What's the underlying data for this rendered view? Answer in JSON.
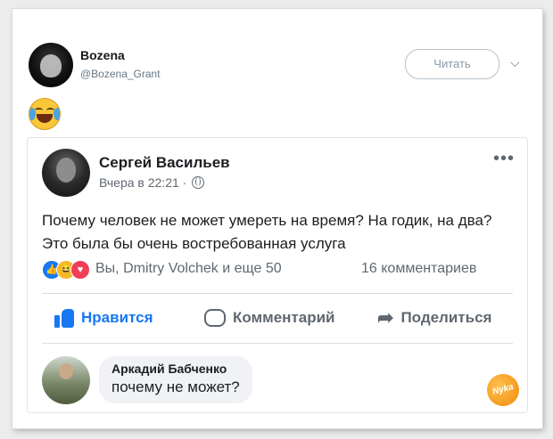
{
  "tweet": {
    "display_name": "Bozena",
    "handle": "@Bozena_Grant",
    "follow_label": "Читать",
    "chevron": "⌵",
    "emoji_name": "face-with-tears-of-joy-icon"
  },
  "fb_post": {
    "author": "Сергей Васильев",
    "time": "Вчера в 22:21 ·",
    "more_label": "•••",
    "text": "Почему человек не может умереть на время? На годик, на два? Это была бы очень востребованная услуга",
    "reactions": {
      "icons": [
        "like-reaction-icon",
        "haha-reaction-icon",
        "love-reaction-icon"
      ],
      "who": "Вы, Dmitry Volchek и еще 50",
      "comments": "16 комментариев"
    },
    "actions": {
      "like": "Нравится",
      "comment": "Комментарий",
      "share": "Поделиться"
    },
    "comment": {
      "author": "Аркадий Бабченко",
      "text": "почему не может?"
    }
  },
  "watermark": "Nyka",
  "colors": {
    "fb_blue": "#1877f2",
    "twitter_gray": "#657786",
    "haha_yellow": "#f7b928",
    "love_red": "#f33e58"
  }
}
